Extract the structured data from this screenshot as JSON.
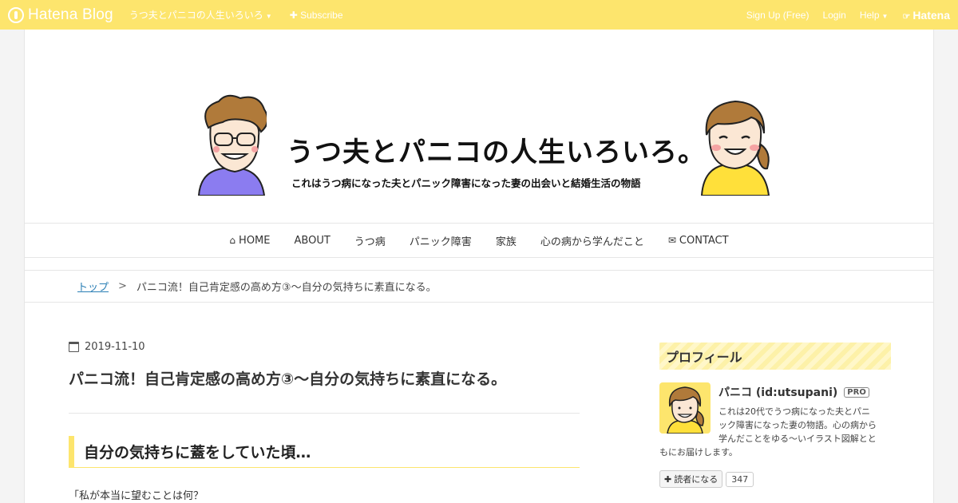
{
  "topbar": {
    "logo": "Hatena Blog",
    "blog_menu": "うつ夫とパニコの人生いろいろ",
    "subscribe": "Subscribe",
    "signup": "Sign Up (Free)",
    "login": "Login",
    "help": "Help",
    "hatena": "Hatena"
  },
  "header": {
    "title": "うつ夫とパニコの人生いろいろ。",
    "subtitle": "これはうつ病になった夫とパニック障害になった妻の出会いと結婚生活の物語"
  },
  "nav": {
    "items": [
      "HOME",
      "ABOUT",
      "うつ病",
      "パニック障害",
      "家族",
      "心の病から学んだこと",
      "CONTACT"
    ]
  },
  "breadcrumb": {
    "top": "トップ",
    "separator": ">",
    "current": "パニコ流！自己肯定感の高め方③～自分の気持ちに素直になる。"
  },
  "article": {
    "date": "2019-11-10",
    "title": "パニコ流！自己肯定感の高め方③～自分の気持ちに素直になる。",
    "heading": "自分の気持ちに蓋をしていた頃…",
    "body": "「私が本当に望むことは何？"
  },
  "sidebar": {
    "section_title": "プロフィール",
    "name": "パニコ (id:utsupani)",
    "badge": "PRO",
    "desc": [
      "これは20代でうつ病になった夫とパニ",
      "ック障害になった妻の物語。心の病から",
      "学んだことをゆる～いイラスト図解とと",
      "もにお届けします。"
    ],
    "subscribe_label": "読者になる",
    "subscriber_count": "347"
  },
  "colors": {
    "accent": "#fde56d",
    "link": "#2b7fb5"
  }
}
